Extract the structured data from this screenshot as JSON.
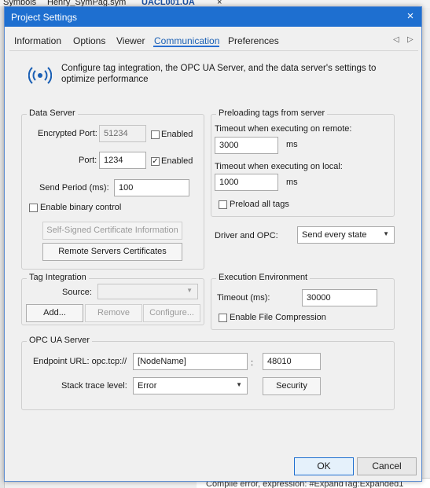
{
  "background": {
    "tabs": [
      {
        "label": "Symbols"
      },
      {
        "label": "Henry_SymPag.sym"
      },
      {
        "label": "UACL001.UA"
      }
    ],
    "status_line": "Compile error, expression: #ExpandTag:Expanded1"
  },
  "dialog": {
    "title": "Project Settings",
    "close_icon": "×",
    "tabs": [
      "Information",
      "Options",
      "Viewer",
      "Communication",
      "Preferences"
    ],
    "active_tab": "Communication",
    "nav_prev": "◁",
    "nav_next": "▷",
    "banner_text": "Configure tag integration, the OPC UA Server, and the data server's settings to optimize performance",
    "data_server": {
      "title": "Data Server",
      "encrypted_port_label": "Encrypted Port:",
      "encrypted_port_value": "51234",
      "encrypted_enabled_label": "Enabled",
      "encrypted_enabled_checked": false,
      "port_label": "Port:",
      "port_value": "1234",
      "port_enabled_label": "Enabled",
      "port_enabled_checked": true,
      "send_period_label": "Send Period (ms):",
      "send_period_value": "100",
      "binary_control_label": "Enable binary control",
      "binary_control_checked": false,
      "self_signed_button": "Self-Signed Certificate Information",
      "remote_certs_button": "Remote Servers Certificates"
    },
    "preloading": {
      "title": "Preloading tags from server",
      "remote_label": "Timeout when executing on remote:",
      "remote_value": "3000",
      "remote_unit": "ms",
      "local_label": "Timeout when executing on local:",
      "local_value": "1000",
      "local_unit": "ms",
      "preload_all_label": "Preload all tags",
      "preload_all_checked": false
    },
    "driver_opc": {
      "label": "Driver and OPC:",
      "value": "Send every state"
    },
    "tag_integration": {
      "title": "Tag Integration",
      "source_label": "Source:",
      "source_value": "",
      "add_button": "Add...",
      "remove_button": "Remove",
      "configure_button": "Configure..."
    },
    "execution": {
      "title": "Execution Environment",
      "timeout_label": "Timeout (ms):",
      "timeout_value": "30000",
      "compression_label": "Enable File Compression",
      "compression_checked": false
    },
    "opc_ua": {
      "title": "OPC UA Server",
      "endpoint_label": "Endpoint URL: opc.tcp://",
      "endpoint_host": "[NodeName]",
      "separator": ":",
      "endpoint_port": "48010",
      "stack_trace_label": "Stack trace level:",
      "stack_trace_value": "Error",
      "security_button": "Security"
    },
    "ok_button": "OK",
    "cancel_button": "Cancel"
  },
  "colors": {
    "titlebar": "#1e6fd0",
    "accent": "#1a5fb4",
    "dialog_bg": "#f0f0f0"
  },
  "icons": {
    "banner": "broadcast-icon",
    "caret": "chevron-down-icon",
    "check": "checkmark-icon"
  }
}
